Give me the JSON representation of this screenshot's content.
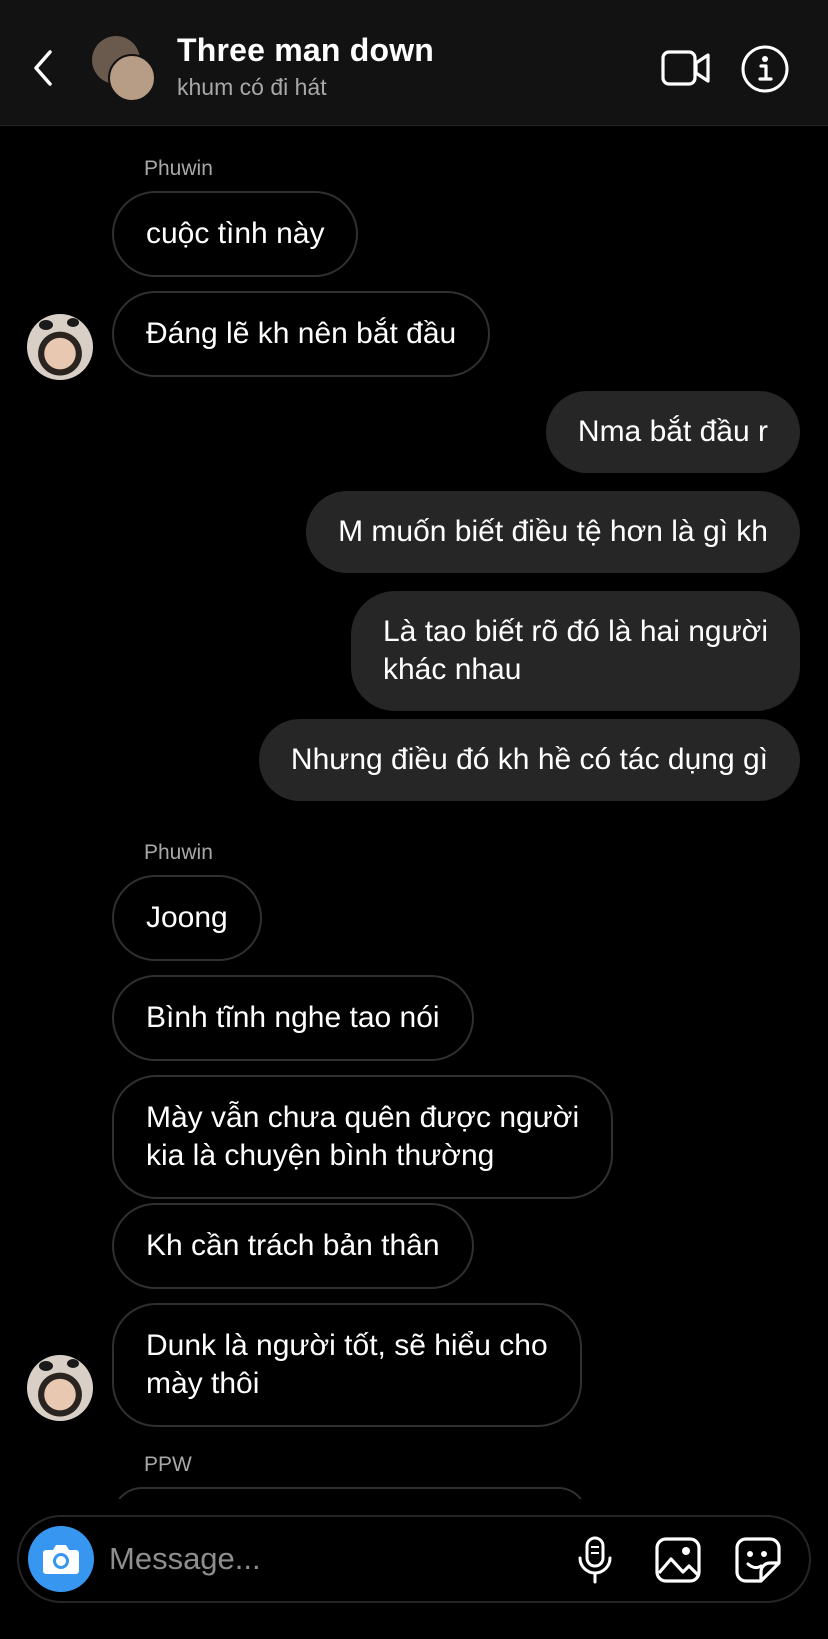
{
  "header": {
    "title": "Three man down",
    "subtitle": "khum có đi hát"
  },
  "messages": {
    "g1_sender": "Phuwin",
    "m1": "cuộc tình này",
    "m2": "Đáng lẽ kh nên bắt đầu",
    "m3": "Nma bắt đầu r",
    "m4": "M muốn biết điều tệ hơn là gì kh",
    "m5": "Là tao biết rõ đó là hai người\nkhác nhau",
    "m6": "Nhưng điều đó kh hề có tác dụng gì",
    "g2_sender": "Phuwin",
    "m7": "Joong",
    "m8": "Bình tĩnh nghe tao nói",
    "m9": "Mày vẫn chưa quên được người\nkia là chuyện bình thường",
    "m10": "Kh cần trách bản thân",
    "m11": "Dunk là người tốt, sẽ hiểu cho\nmày thôi",
    "g3_sender": "PPW"
  },
  "composer": {
    "placeholder": "Message..."
  },
  "icons": {
    "back": "chevron-left-icon",
    "video": "video-camera-icon",
    "info": "info-icon",
    "camera": "camera-icon",
    "mic": "microphone-icon",
    "gallery": "image-icon",
    "sticker": "sticker-icon"
  },
  "colors": {
    "background": "#000000",
    "header": "#121212",
    "outgoing_bubble": "#262626",
    "incoming_border": "#303030",
    "accent": "#3797f0",
    "secondary_text": "#a8a8a8"
  }
}
